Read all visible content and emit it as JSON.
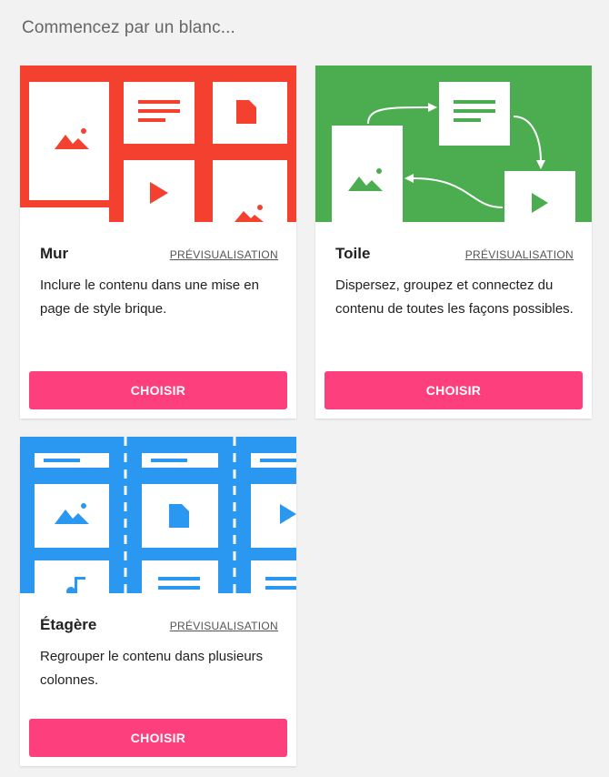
{
  "heading": "Commencez par un blanc...",
  "colors": {
    "wall": "#f3402f",
    "canvas": "#4cad50",
    "shelf": "#2a97f0",
    "button": "#fd3f7d"
  },
  "cards": [
    {
      "title": "Mur",
      "preview_label": "PRÉVISUALISATION",
      "description": "Inclure le contenu dans une mise en page de style brique.",
      "button_label": "CHOISIR"
    },
    {
      "title": "Toile",
      "preview_label": "PRÉVISUALISATION",
      "description": "Dispersez, groupez et connectez du contenu de toutes les façons possibles.",
      "button_label": "CHOISIR"
    },
    {
      "title": "Étagère",
      "preview_label": "PRÉVISUALISATION",
      "description": "Regrouper le contenu dans plusieurs colonnes.",
      "button_label": "CHOISIR"
    }
  ]
}
